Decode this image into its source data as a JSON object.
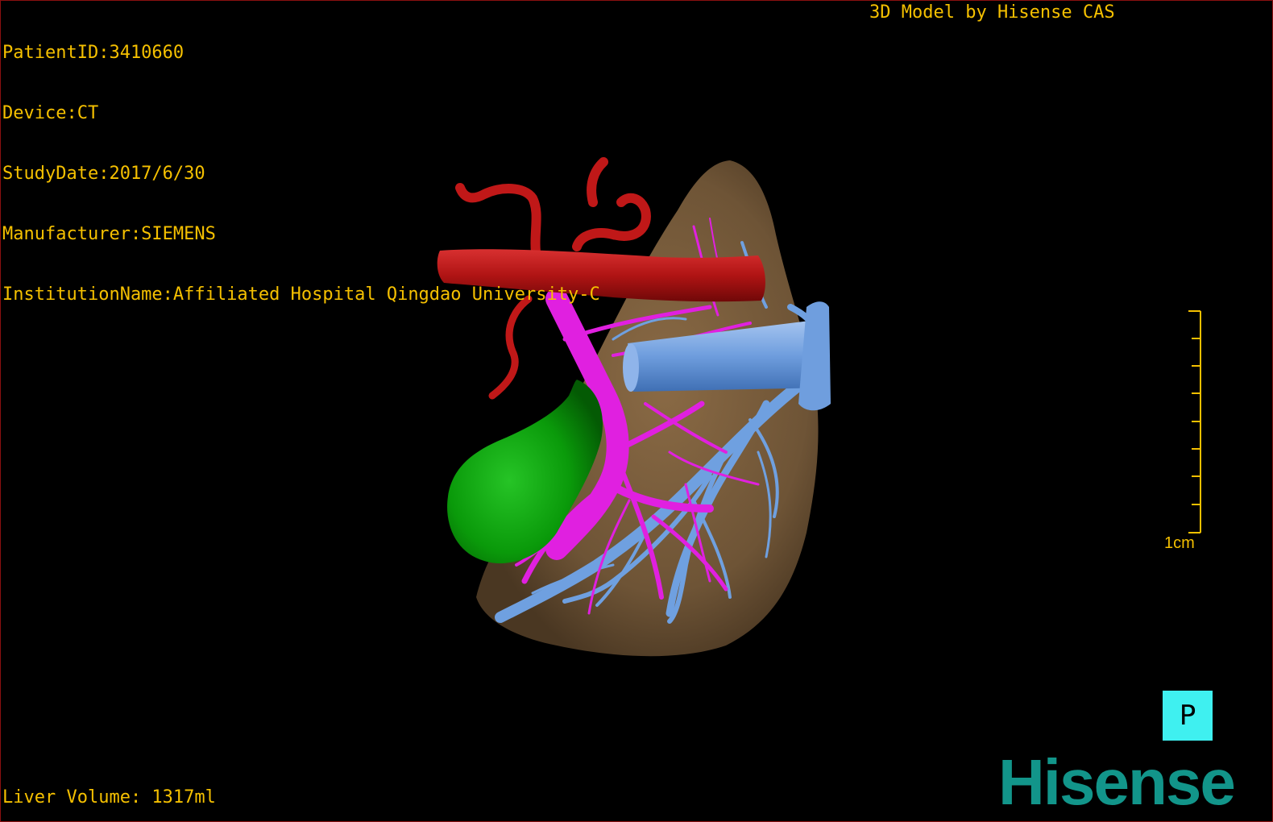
{
  "dicom": {
    "patient_id": "PatientID:3410660",
    "device": "Device:CT",
    "study_date": "StudyDate:2017/6/30",
    "manufacturer": "Manufacturer:SIEMENS",
    "institution": "InstitutionName:Affiliated Hospital Qingdao University-C"
  },
  "brand_caption": "3D Model by Hisense CAS",
  "liver_volume": "Liver Volume: 1317ml",
  "scale": {
    "label": "1cm"
  },
  "orientation": {
    "label": "P"
  },
  "logo": {
    "text": "Hisense"
  },
  "colors": {
    "overlay_text": "#f5c000",
    "liver": "#6e5436",
    "artery": "#c01818",
    "portal_vein": "#e020e0",
    "hepatic_vein": "#6fa0e0",
    "gallbladder": "#0a9a0a",
    "orientation_cube": "#3ff0f0",
    "logo": "#12958a",
    "border": "#8a1010"
  }
}
